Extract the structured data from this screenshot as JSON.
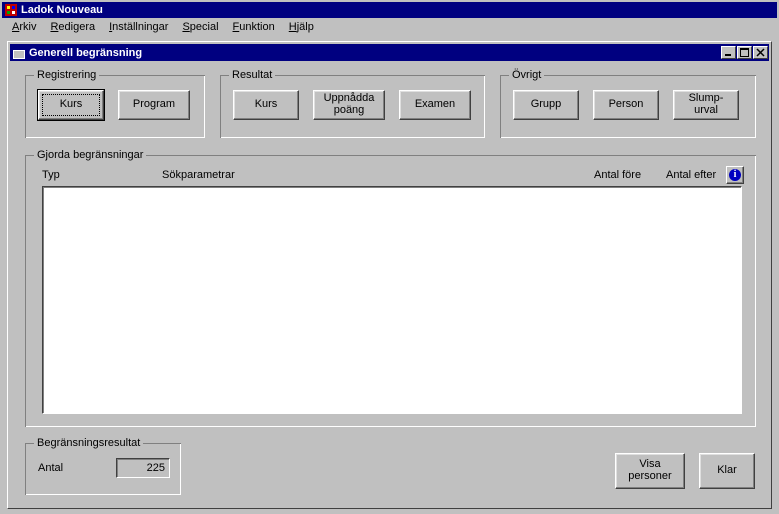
{
  "app": {
    "title": "Ladok Nouveau"
  },
  "menu": {
    "items": [
      {
        "label": "Arkiv",
        "hotidx": 0
      },
      {
        "label": "Redigera",
        "hotidx": 0
      },
      {
        "label": "Inställningar",
        "hotidx": 0
      },
      {
        "label": "Special",
        "hotidx": 0
      },
      {
        "label": "Funktion",
        "hotidx": 0
      },
      {
        "label": "Hjälp",
        "hotidx": 0
      }
    ]
  },
  "child": {
    "title": "Generell begränsning"
  },
  "groups": {
    "registrering": {
      "caption": "Registrering",
      "kurs": "Kurs",
      "program": "Program"
    },
    "resultat": {
      "caption": "Resultat",
      "kurs": "Kurs",
      "uppnadda": "Uppnådda\npoäng",
      "examen": "Examen"
    },
    "ovrigt": {
      "caption": "Övrigt",
      "grupp": "Grupp",
      "person": "Person",
      "slump": "Slump-\nurval"
    },
    "gjorda": {
      "caption": "Gjorda begränsningar",
      "col_typ": "Typ",
      "col_sokparam": "Sökparametrar",
      "col_antal_fore": "Antal före",
      "col_antal_efter": "Antal efter"
    },
    "resultat2": {
      "caption": "Begränsningsresultat",
      "antal_label": "Antal",
      "antal_value": "225"
    }
  },
  "buttons": {
    "visa_personer": "Visa\npersoner",
    "klar": "Klar"
  }
}
